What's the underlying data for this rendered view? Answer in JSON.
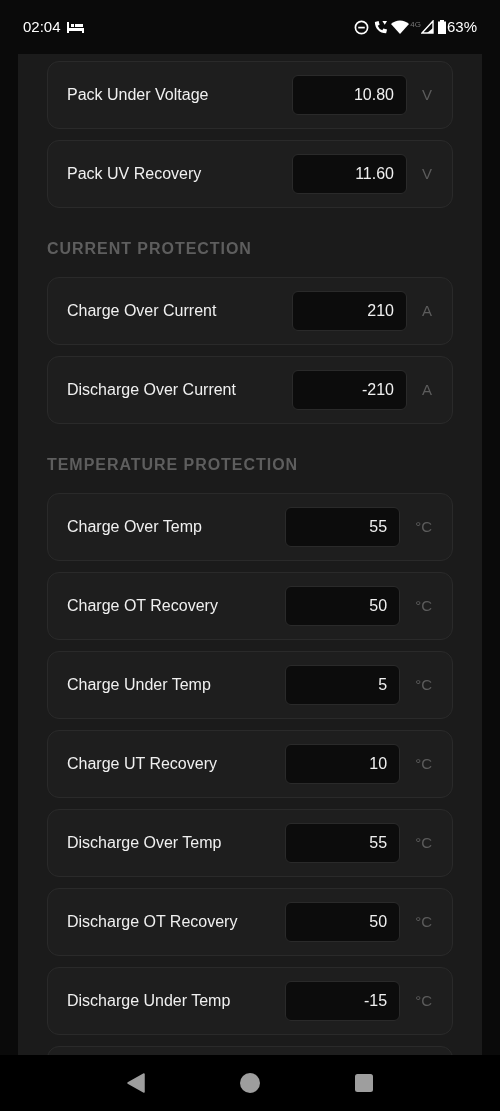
{
  "status_bar": {
    "time": "02:04",
    "network": "4G",
    "battery": "63%"
  },
  "sections": [
    {
      "items": [
        {
          "label": "Pack Under Voltage",
          "value": "10.80",
          "unit": "V"
        },
        {
          "label": "Pack UV Recovery",
          "value": "11.60",
          "unit": "V"
        }
      ]
    },
    {
      "heading": "CURRENT PROTECTION",
      "items": [
        {
          "label": "Charge Over Current",
          "value": "210",
          "unit": "A"
        },
        {
          "label": "Discharge Over Current",
          "value": "-210",
          "unit": "A"
        }
      ]
    },
    {
      "heading": "TEMPERATURE PROTECTION",
      "items": [
        {
          "label": "Charge Over Temp",
          "value": "55",
          "unit": "°C"
        },
        {
          "label": "Charge OT Recovery",
          "value": "50",
          "unit": "°C"
        },
        {
          "label": "Charge Under Temp",
          "value": "5",
          "unit": "°C"
        },
        {
          "label": "Charge UT Recovery",
          "value": "10",
          "unit": "°C"
        },
        {
          "label": "Discharge Over Temp",
          "value": "55",
          "unit": "°C"
        },
        {
          "label": "Discharge OT Recovery",
          "value": "50",
          "unit": "°C"
        },
        {
          "label": "Discharge Under Temp",
          "value": "-15",
          "unit": "°C"
        }
      ]
    }
  ]
}
